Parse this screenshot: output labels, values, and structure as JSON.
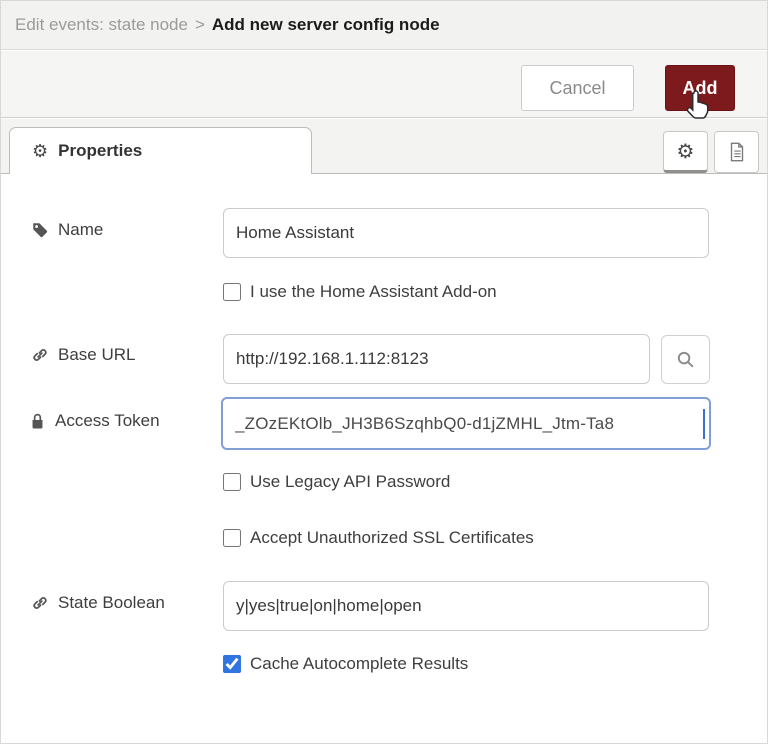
{
  "header": {
    "breadcrumb_prefix": "Edit events: state node",
    "breadcrumb_separator": ">",
    "title": "Add new server config node"
  },
  "toolbar": {
    "cancel_label": "Cancel",
    "add_label": "Add"
  },
  "tabs": {
    "properties_label": "Properties"
  },
  "icons": {
    "properties_gear_glyph": "⚙",
    "settings_gear_glyph": "⚙",
    "doc_icon": "document-icon",
    "search_icon": "magnifier-icon",
    "name_icon": "tag-icon",
    "base_url_icon": "link-icon",
    "access_token_icon": "lock-icon",
    "state_boolean_icon": "link-icon",
    "cursor_icon": "hand-pointer-icon"
  },
  "form": {
    "name": {
      "label": "Name",
      "value": "Home Assistant"
    },
    "addon_checkbox": {
      "label": "I use the Home Assistant Add-on",
      "checked": false
    },
    "base_url": {
      "label": "Base URL",
      "value": "http://192.168.1.112:8123"
    },
    "access_token": {
      "label": "Access Token",
      "value": "_ZOzEKtOlb_JH3B6SzqhbQ0-d1jZMHL_Jtm-Ta8"
    },
    "legacy_checkbox": {
      "label": "Use Legacy API Password",
      "checked": false
    },
    "ssl_checkbox": {
      "label": "Accept Unauthorized SSL Certificates",
      "checked": false
    },
    "state_boolean": {
      "label": "State Boolean",
      "value": "y|yes|true|on|home|open"
    },
    "cache_checkbox": {
      "label": "Cache Autocomplete Results",
      "checked": true
    }
  },
  "colors": {
    "add_button_maroon": "#7d1a1d",
    "checkbox_blue": "#2f74e0",
    "focus_border_blue": "#7f9fd6",
    "header_bg": "#f2f2f0",
    "tabbar_bg": "#f3f3f1"
  }
}
